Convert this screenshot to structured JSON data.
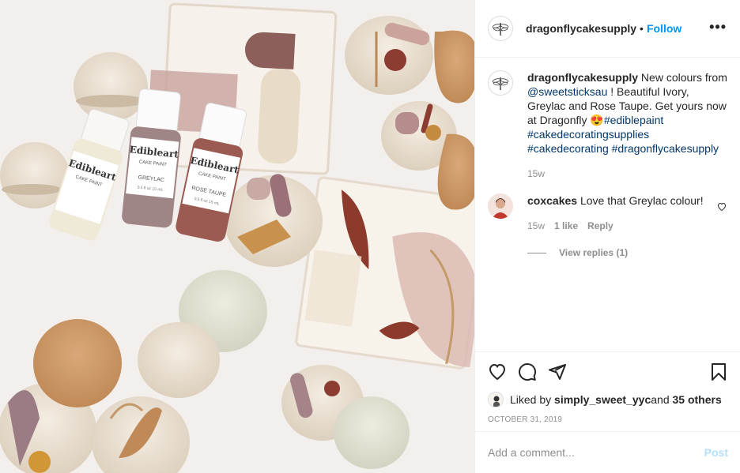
{
  "header": {
    "username": "dragonflycakesupply",
    "separator": "•",
    "follow_label": "Follow",
    "more_label": "•••"
  },
  "caption": {
    "username": "dragonflycakesupply",
    "text_1": " New colours from ",
    "mention": "@sweetsticksau",
    "text_2": " ! Beautiful Ivory, Greylac and Rose Taupe. Get yours now at Dragonfly ",
    "emoji": "😍",
    "hashtag_1": "#ediblepaint",
    "hashtag_2": "#cakedecoratingsupplies",
    "hashtag_3": "#cakedecorating",
    "hashtag_4": "#dragonflycakesupply",
    "time": "15w"
  },
  "comment": {
    "username": "coxcakes",
    "text": " Love that Greylac colour!",
    "time": "15w",
    "likes": "1 like",
    "reply_label": "Reply",
    "view_replies": "View replies (1)"
  },
  "likes": {
    "prefix": "Liked by ",
    "user": "simply_sweet_yyc",
    "and": " and ",
    "others": "35 others"
  },
  "date": "OCTOBER 31, 2019",
  "add_comment": {
    "placeholder": "Add a comment...",
    "post_label": "Post"
  },
  "media": {
    "bottles": [
      {
        "brand": "Edibleart",
        "sub": "CAKE PAINT",
        "color_name": "",
        "size": "0.5 fl oz  15 mL"
      },
      {
        "brand": "Edibleart",
        "sub": "CAKE PAINT",
        "color_name": "GREYLAC",
        "size": "0.5 fl oz  15 mL"
      },
      {
        "brand": "Edibleart",
        "sub": "CAKE PAINT",
        "color_name": "ROSE TAUPE",
        "size": "0.5 fl oz  15 mL"
      }
    ]
  },
  "colors": {
    "link": "#00376b",
    "follow": "#0095f6",
    "muted": "#8e8e8e",
    "post_disabled": "#b2dffc"
  }
}
